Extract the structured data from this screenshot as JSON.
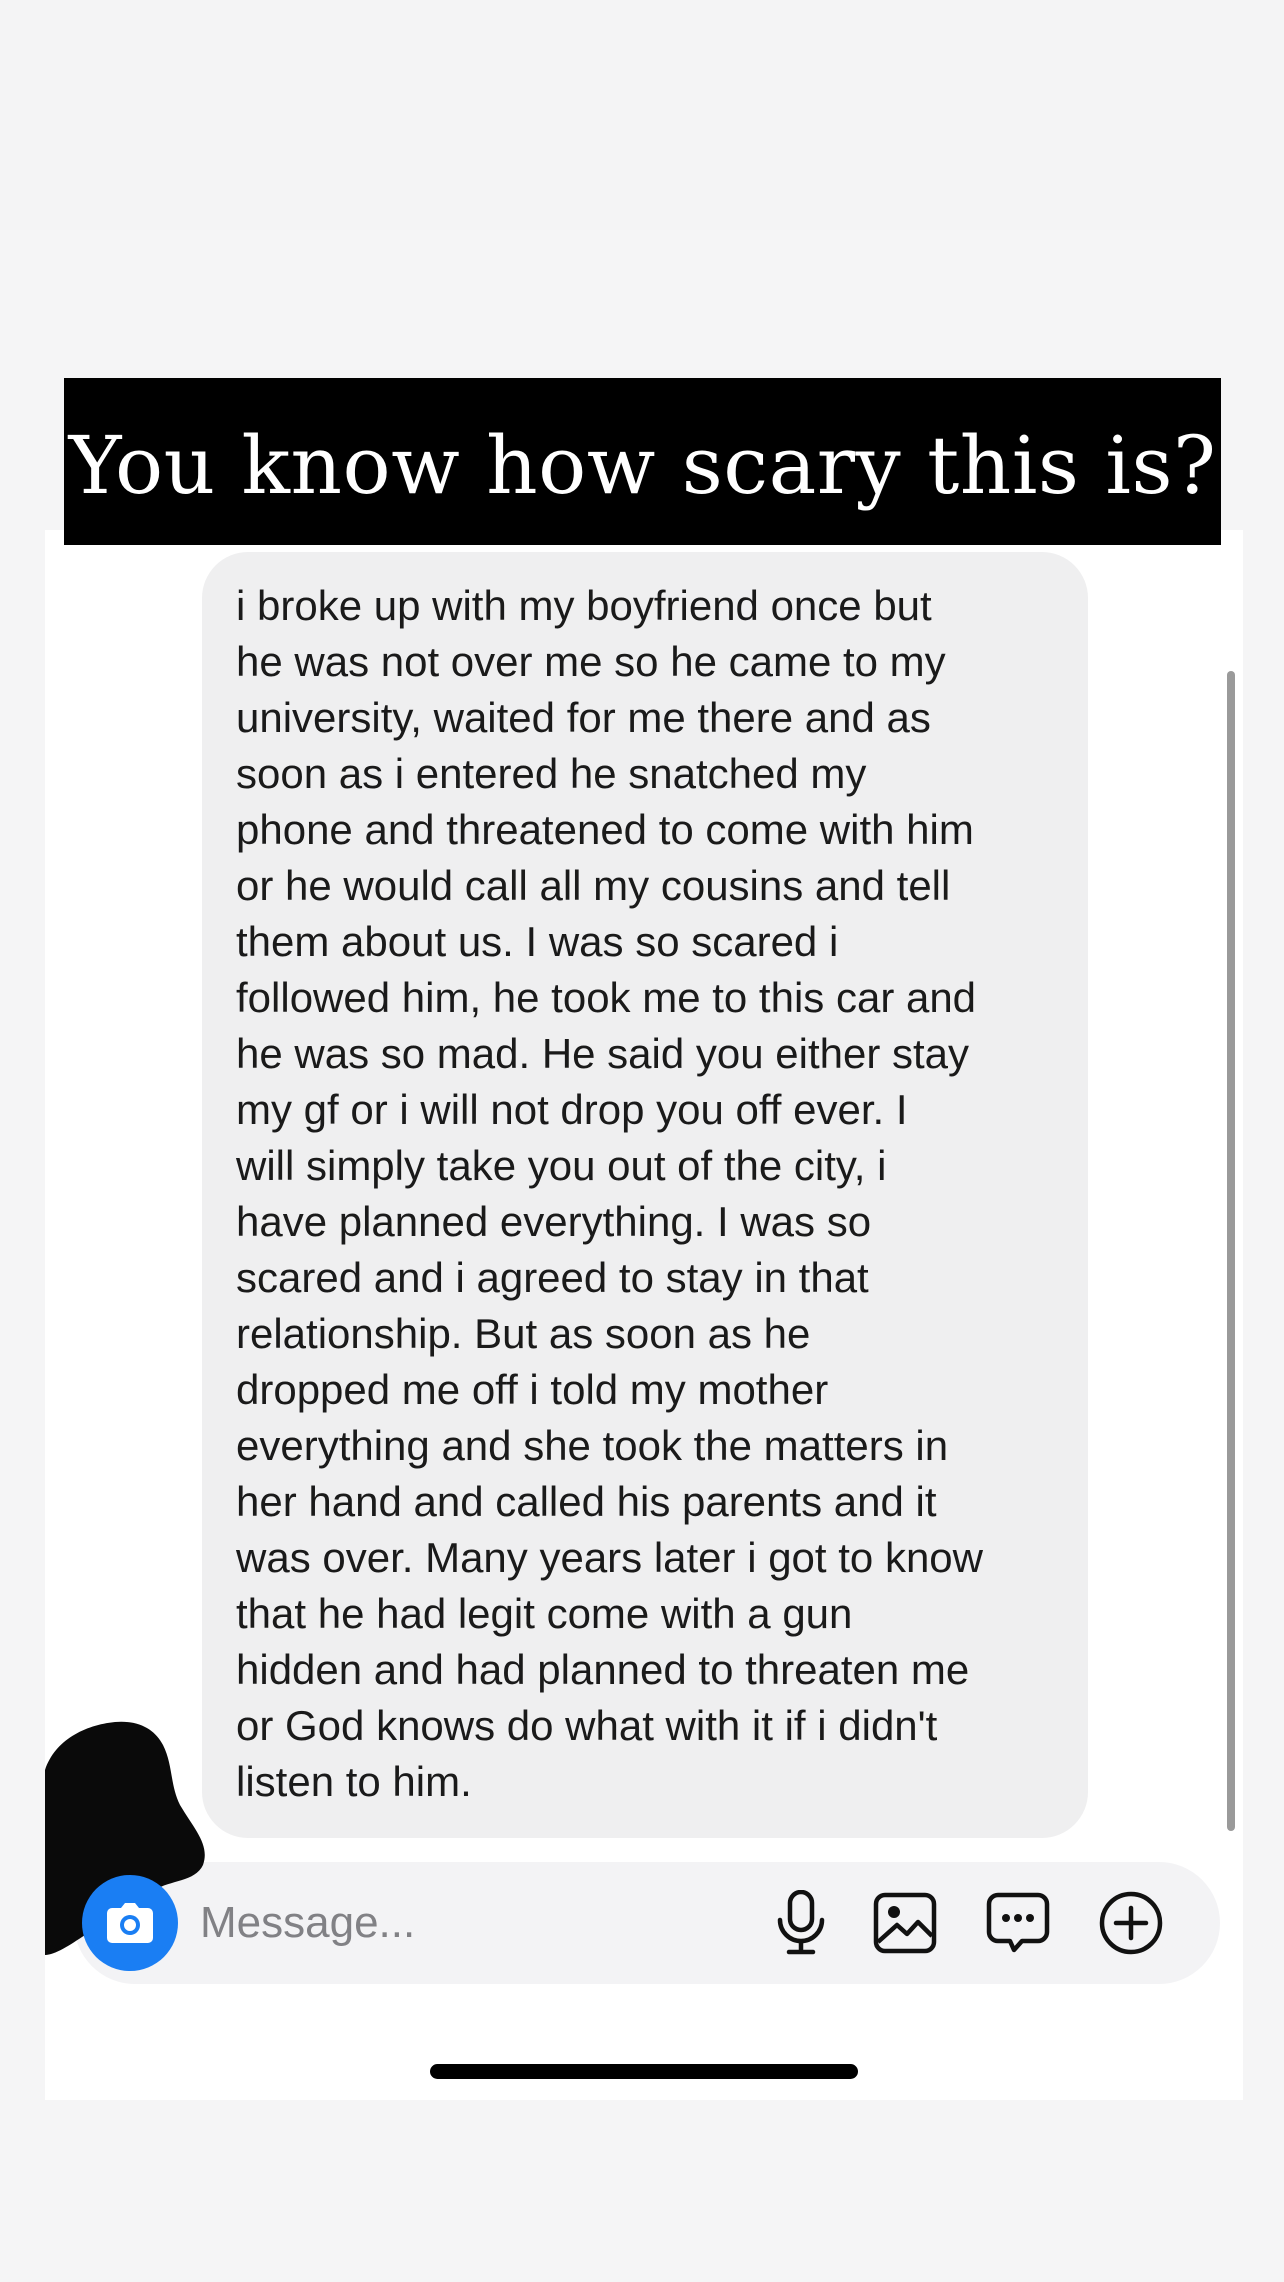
{
  "title_banner": {
    "text": "You know how scary this is?"
  },
  "message": {
    "text": "i broke up with my boyfriend once but\nhe was not over me so he came to my\nuniversity, waited for me there and as\nsoon as i entered he snatched my\nphone and threatened to come with him\nor he would call all my cousins and tell\nthem about us. I was so scared i\nfollowed him, he took me to this car and\nhe was so mad. He said you either stay\nmy gf or i will not drop you off ever. I\nwill simply take you out of the city, i\nhave planned everything. I was so\nscared and i agreed to stay in that\nrelationship.  But as soon as he\ndropped me off i told my mother\neverything and she took the matters in\nher hand and called his parents and it\nwas over. Many years later i got to know\nthat he had legit come with a gun\nhidden and had planned to threaten me\nor God knows do what with it if i didn't\nlisten to him."
  },
  "composer": {
    "placeholder": "Message...",
    "icons": [
      "camera-icon",
      "microphone-icon",
      "image-icon",
      "sticker-chat-icon",
      "add-icon"
    ]
  },
  "colors": {
    "banner_bg": "#000000",
    "bubble_bg": "#efeff0",
    "camera_accent": "#1a7ef3",
    "composer_bg": "#f3f3f5"
  }
}
